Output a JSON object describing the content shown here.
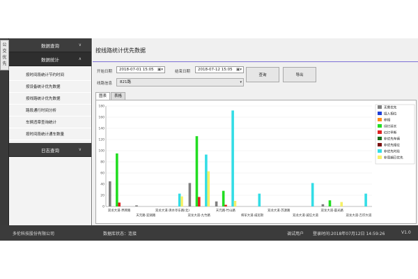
{
  "left_strip": {
    "label": "公交优先"
  },
  "sidebar": {
    "sections": [
      {
        "label": "数据查询",
        "chevron": "chevron-down-icon"
      },
      {
        "label": "数据统计",
        "chevron": "chevron-up-icon"
      },
      {
        "label": "日志查询",
        "chevron": "chevron-down-icon"
      }
    ],
    "items": [
      "按时间段统计节约时间",
      "按设备统计优先数据",
      "按线路统计优先数据",
      "路段通行时间分析",
      "车辆违章查询统计",
      "按时间段统计通车数量"
    ]
  },
  "main": {
    "title": "按线路统计优先数据",
    "start_label": "开始日期",
    "start_value": "2018-07-01 15:05",
    "end_label": "结束日期",
    "end_value": "2018-07-12 15:05",
    "line_label": "线路信息",
    "line_value": "821路",
    "query_button": "查询",
    "export_button": "导出",
    "tabs": [
      "图表",
      "表格"
    ]
  },
  "chart_data": {
    "type": "bar",
    "ylim": [
      0,
      180
    ],
    "yticks": [
      "180",
      "160",
      "140",
      "120",
      "100",
      "80",
      "60",
      "40",
      "20",
      "0"
    ],
    "categories": [
      "双龙大道-界牌路",
      "天元路-迎湖路",
      "双龙大道-清水亭东路(北)",
      "双龙大道-九竹路",
      "天元路-竹山路",
      "将军大道-威尼斯",
      "双龙大道-苏源路",
      "双龙大道-诚信大道",
      "双龙大道-晨光路",
      "双龙大道-吉印大道"
    ],
    "series": [
      {
        "name": "无需优先",
        "color": "#7f7f7f",
        "values": [
          45,
          2,
          0,
          42,
          9,
          0,
          0,
          0,
          4,
          0
        ]
      },
      {
        "name": "插入相位",
        "color": "#1f3fd6",
        "values": [
          0,
          0,
          0,
          0,
          0,
          0,
          0,
          0,
          0,
          0
        ]
      },
      {
        "name": "移相",
        "color": "#ff8c1a",
        "values": [
          0,
          0,
          0,
          0,
          0,
          0,
          0,
          0,
          0,
          0
        ]
      },
      {
        "name": "绿灯延长",
        "color": "#22dd22",
        "values": [
          95,
          0,
          0,
          126,
          28,
          0,
          0,
          0,
          11,
          0
        ]
      },
      {
        "name": "红灯早断",
        "color": "#dd2222",
        "values": [
          7,
          0,
          0,
          17,
          3,
          0,
          0,
          0,
          0,
          0
        ]
      },
      {
        "name": "非优先车辆",
        "color": "#1a6e1a",
        "values": [
          0,
          0,
          0,
          0,
          0,
          0,
          0,
          0,
          0,
          0
        ]
      },
      {
        "name": "非优先相位",
        "color": "#7a1010",
        "values": [
          0,
          0,
          0,
          0,
          0,
          0,
          0,
          0,
          0,
          0
        ]
      },
      {
        "name": "非优先时段",
        "color": "#33dde6",
        "values": [
          0,
          0,
          23,
          93,
          172,
          23,
          0,
          42,
          0,
          23
        ]
      },
      {
        "name": "非周期已优先",
        "color": "#f6f066",
        "values": [
          0,
          0,
          18,
          63,
          10,
          0,
          0,
          0,
          8,
          0
        ]
      }
    ]
  },
  "statusbar": {
    "company": "多伦科技股份有限公司",
    "db_status": "数据库状态：连接",
    "user": "调试用户",
    "login_time": "登录时间:2018年07月12日 14:59:26",
    "version": "V1.0"
  }
}
